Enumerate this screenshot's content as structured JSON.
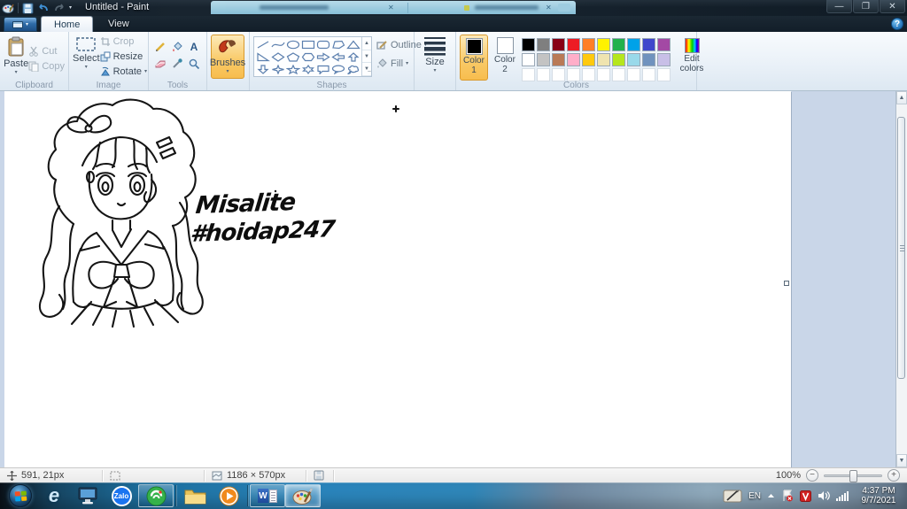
{
  "titlebar": {
    "title": "Untitled - Paint"
  },
  "tabs": {
    "home": "Home",
    "view": "View"
  },
  "ribbon": {
    "clipboard": {
      "label": "Clipboard",
      "paste": "Paste",
      "cut": "Cut",
      "copy": "Copy"
    },
    "image": {
      "label": "Image",
      "select": "Select",
      "crop": "Crop",
      "resize": "Resize",
      "rotate": "Rotate"
    },
    "tools": {
      "label": "Tools"
    },
    "brushes": {
      "label": "Brushes"
    },
    "shapes": {
      "label": "Shapes",
      "outline": "Outline",
      "fill": "Fill"
    },
    "size": {
      "label": "Size"
    },
    "colors": {
      "label": "Colors",
      "color1": "Color 1",
      "color2": "Color 2",
      "edit": "Edit colors",
      "color1_value": "#000000",
      "color2_value": "#ffffff",
      "row1": [
        "#000000",
        "#7f7f7f",
        "#880015",
        "#ed1c24",
        "#ff7f27",
        "#fff200",
        "#22b14c",
        "#00a2e8",
        "#3f48cc",
        "#a349a4"
      ],
      "row2": [
        "#ffffff",
        "#c3c3c3",
        "#b97a57",
        "#ffaec9",
        "#ffc90e",
        "#efe4b0",
        "#b5e61d",
        "#99d9ea",
        "#7092be",
        "#c8bfe7"
      ]
    }
  },
  "canvas": {
    "annotation_line1": "Misalite",
    "annotation_line2": "#hoidap247"
  },
  "statusbar": {
    "cursor_position": "591, 21px",
    "image_size": "1186 × 570px",
    "zoom_level": "100%"
  },
  "taskbar": {
    "zalo_label": "Zalo",
    "word_label": "W",
    "tray": {
      "language": "EN",
      "time": "4:37 PM",
      "date": "9/7/2021"
    }
  },
  "icons": {
    "text_tool": "A",
    "ie": "e",
    "help": "?"
  },
  "theme": {
    "selection_orange": "#f9c966",
    "title_glass": "#131f2a",
    "work_bg": "#c9d6e8",
    "taskbar_blue": "#2a84bb"
  }
}
